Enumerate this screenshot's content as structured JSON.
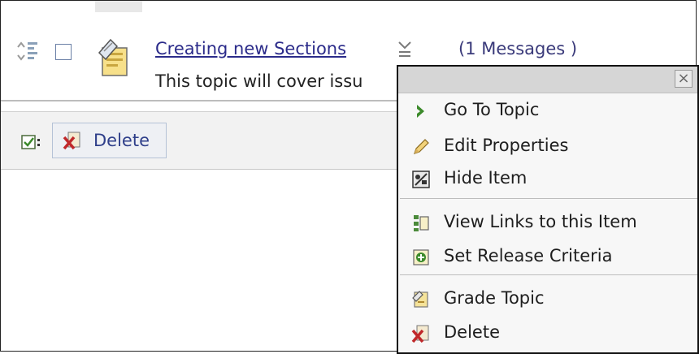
{
  "topic": {
    "title": "Creating new Sections",
    "message_count": "(1 Messages )",
    "description": "This topic will cover issu"
  },
  "action_bar": {
    "delete_label": "Delete"
  },
  "context_menu": {
    "close_glyph": "×",
    "items": [
      {
        "label": "Go To Topic",
        "icon": "arrow-right-icon"
      },
      {
        "label": "Edit Properties",
        "icon": "pencil-icon"
      },
      {
        "label": "Hide Item",
        "icon": "hide-icon"
      },
      {
        "label": "View Links to this Item",
        "icon": "links-icon"
      },
      {
        "label": "Set Release Criteria",
        "icon": "release-criteria-icon"
      },
      {
        "label": "Grade Topic",
        "icon": "grade-icon"
      },
      {
        "label": "Delete",
        "icon": "delete-icon"
      }
    ]
  },
  "colors": {
    "link": "#2b2b8a",
    "menu_bg": "#f7f7f7",
    "menu_header": "#d6d6d6",
    "accent_green": "#3c8a2b",
    "delete_red": "#c0282a"
  }
}
